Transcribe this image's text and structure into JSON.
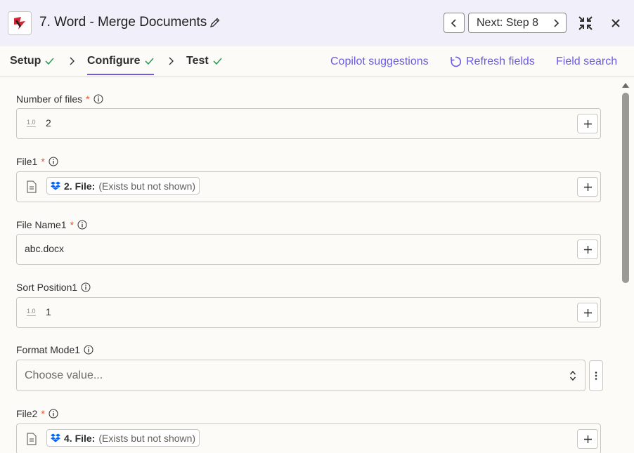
{
  "header": {
    "step_title": "7. Word - Merge Documents",
    "next_label": "Next: Step 8"
  },
  "tabs": {
    "setup": "Setup",
    "configure": "Configure",
    "test": "Test"
  },
  "actions": {
    "copilot": "Copilot suggestions",
    "refresh": "Refresh fields",
    "search": "Field search"
  },
  "fields": {
    "num_files": {
      "label": "Number of files",
      "value": "2"
    },
    "file1": {
      "label": "File1",
      "pill_strong": "2. File:",
      "pill_muted": "(Exists but not shown)"
    },
    "file_name1": {
      "label": "File Name1",
      "value": "abc.docx"
    },
    "sort_position1": {
      "label": "Sort Position1",
      "value": "1"
    },
    "format_mode1": {
      "label": "Format Mode1",
      "placeholder": "Choose value..."
    },
    "file2": {
      "label": "File2",
      "pill_strong": "4. File:",
      "pill_muted": "(Exists but not shown)"
    }
  },
  "labels": {
    "required_mark": "*",
    "number_type_icon": "1.0"
  },
  "colors": {
    "accent": "#695be8",
    "required": "#e8542c",
    "success": "#2f9e5a",
    "dropbox": "#0061fe"
  },
  "icons": {
    "app": "word-app-logo",
    "edit": "pencil-icon",
    "prev": "chevron-left-icon",
    "next": "chevron-right-icon",
    "collapse": "collapse-icon",
    "close": "close-icon",
    "check": "check-icon",
    "refresh": "refresh-icon",
    "info": "info-icon",
    "add": "plus-icon",
    "file": "document-icon",
    "dropbox": "dropbox-icon",
    "more": "more-vertical-icon"
  }
}
